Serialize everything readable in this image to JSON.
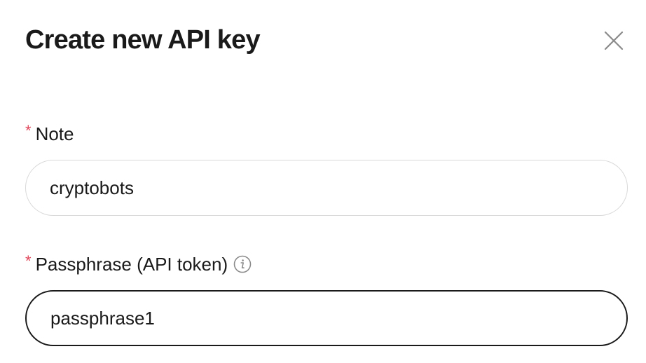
{
  "dialog": {
    "title": "Create new API key",
    "close_icon": "close-icon"
  },
  "form": {
    "note": {
      "required_mark": "*",
      "label": "Note",
      "value": "cryptobots"
    },
    "passphrase": {
      "required_mark": "*",
      "label": "Passphrase (API token)",
      "info_icon": "info-icon",
      "value": "passphrase1"
    }
  },
  "colors": {
    "required": "#e0455a",
    "text": "#1a1a1a",
    "border_default": "#d9d9d9",
    "border_focused": "#1a1a1a",
    "icon": "#8a8a8a"
  }
}
